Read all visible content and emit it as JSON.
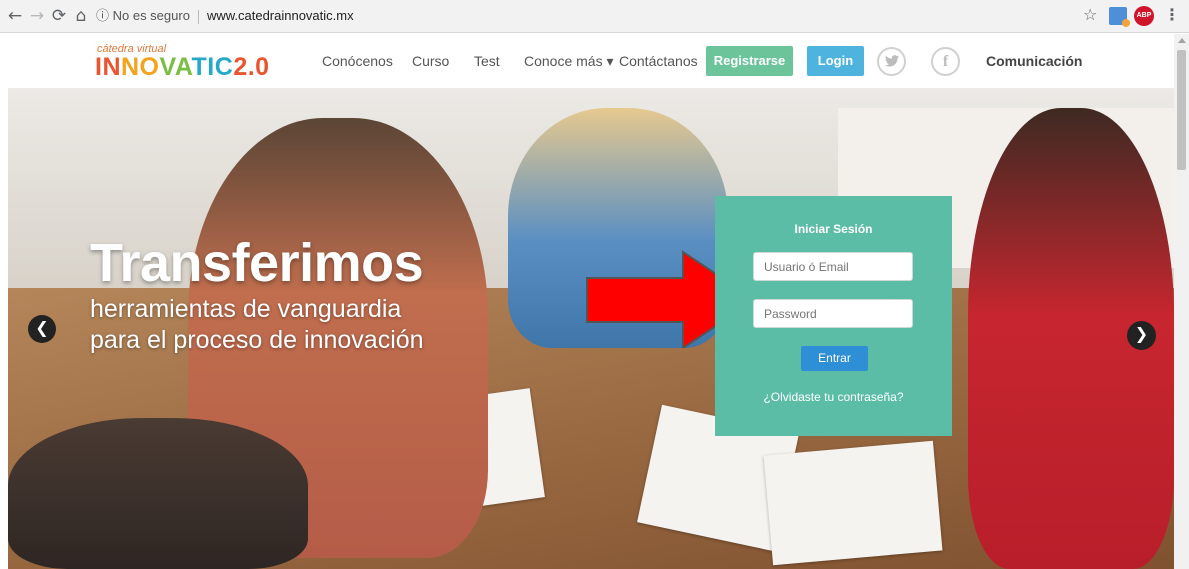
{
  "browser": {
    "security_label": "ⓘ No es seguro",
    "url": "www.catedrainnovatic.mx"
  },
  "header": {
    "logo_sub": "cátedra virtual",
    "logo_letters": [
      "IN",
      "NO",
      "VA",
      "TIC",
      "2.0"
    ],
    "nav": [
      "Conócenos",
      "Curso",
      "Test",
      "Conoce más ▾",
      "Contáctanos"
    ],
    "register_label": "Registrarse",
    "login_label": "Login",
    "twitter_icon": "twitter-icon",
    "facebook_icon": "facebook-icon",
    "communication_label": "Comunicación"
  },
  "hero": {
    "title": "Transferimos",
    "subtitle_line1": "herramientas de vanguardia",
    "subtitle_line2": "para el proceso de innovación"
  },
  "login": {
    "title": "Iniciar Sesión",
    "username_placeholder": "Usuario ó Email",
    "password_placeholder": "Password",
    "submit_label": "Entrar",
    "forgot_label": "¿Olvidaste tu contraseña?"
  },
  "colors": {
    "card": "#5cbda6",
    "register": "#6cc49b",
    "login": "#4fb4dd",
    "submit": "#2e8fd6",
    "annotation_arrow": "#ff0000"
  }
}
